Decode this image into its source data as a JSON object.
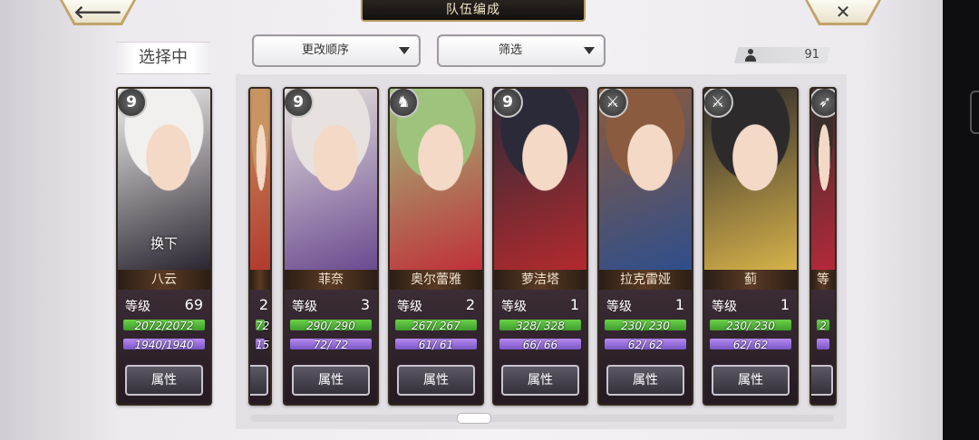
{
  "header": {
    "title": "队伍编成",
    "back_icon": "🡐",
    "close_icon": "✕"
  },
  "tab": {
    "selecting_label": "选择中"
  },
  "controls": {
    "sort_label": "更改顺序",
    "filter_label": "筛选"
  },
  "roster_count": "91",
  "common": {
    "level_label": "等级",
    "attr_label": "属性",
    "swap_label": "换下"
  },
  "cards": [
    {
      "name": "八云",
      "level": "69",
      "hp": "2072/2072",
      "mp": "1940/1940",
      "role": "9",
      "palette": [
        "#f2f0ef",
        "#2a2530"
      ],
      "selected": true
    },
    {
      "name": "",
      "level": "2",
      "hp": "72",
      "mp": "15",
      "role": "",
      "palette": [
        "#c79462",
        "#b23a2e"
      ]
    },
    {
      "name": "菲奈",
      "level": "3",
      "hp": "290/ 290",
      "mp": "72/ 72",
      "role": "9",
      "palette": [
        "#e7e2df",
        "#6a4a8f"
      ]
    },
    {
      "name": "奥尔蕾雅",
      "level": "2",
      "hp": "267/ 267",
      "mp": "61/ 61",
      "role": "♞",
      "palette": [
        "#9dc37c",
        "#c0303a"
      ]
    },
    {
      "name": "萝洁塔",
      "level": "1",
      "hp": "328/ 328",
      "mp": "66/ 66",
      "role": "9",
      "palette": [
        "#2b2a38",
        "#b22a2d"
      ]
    },
    {
      "name": "拉克雷娅",
      "level": "1",
      "hp": "230/ 230",
      "mp": "62/ 62",
      "role": "⚔",
      "palette": [
        "#8a5b3e",
        "#2f4e8c"
      ]
    },
    {
      "name": "蓟",
      "level": "1",
      "hp": "230/ 230",
      "mp": "62/ 62",
      "role": "⚔",
      "palette": [
        "#2d2a2c",
        "#d6b24a"
      ]
    },
    {
      "name": "等",
      "level": "",
      "hp": "2",
      "mp": "",
      "role": "➶",
      "palette": [
        "#3a2f2c",
        "#b3293a"
      ]
    }
  ]
}
